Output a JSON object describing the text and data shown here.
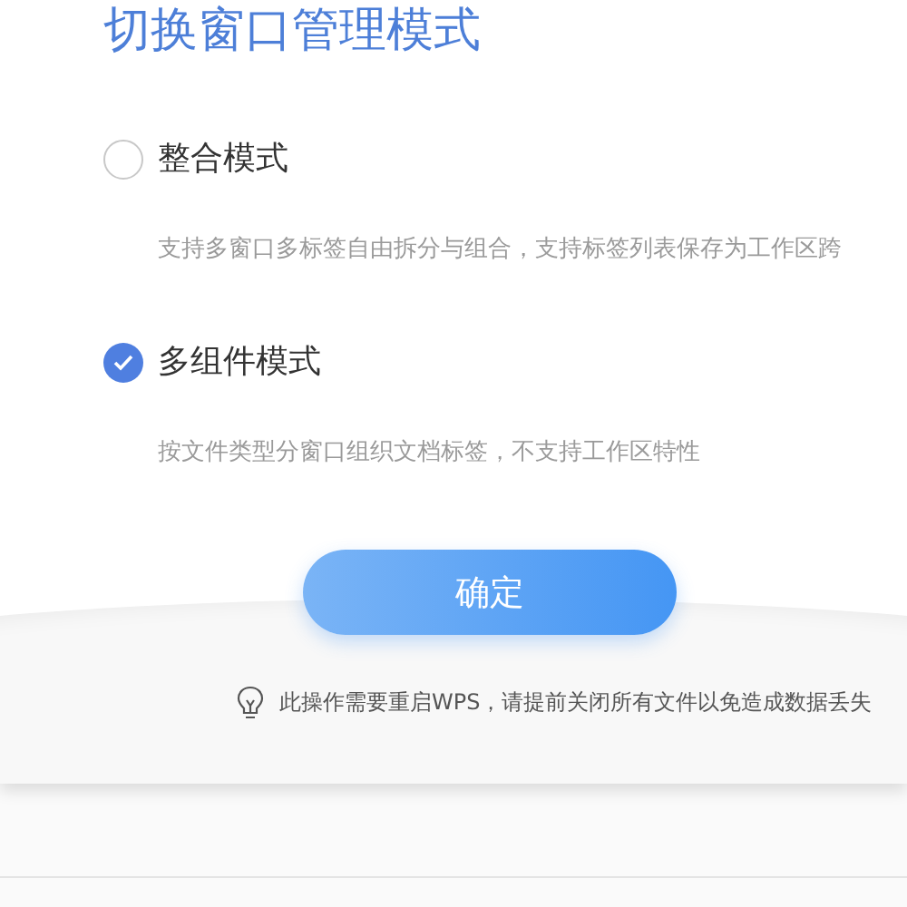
{
  "dialog": {
    "title": "切换窗口管理模式",
    "options": [
      {
        "label": "整合模式",
        "description": "支持多窗口多标签自由拆分与组合，支持标签列表保存为工作区跨",
        "selected": false
      },
      {
        "label": "多组件模式",
        "description": "按文件类型分窗口组织文档标签，不支持工作区特性",
        "selected": true
      }
    ],
    "confirm_button": "确定",
    "hint": "此操作需要重启WPS，请提前关闭所有文件以免造成数据丢失"
  }
}
